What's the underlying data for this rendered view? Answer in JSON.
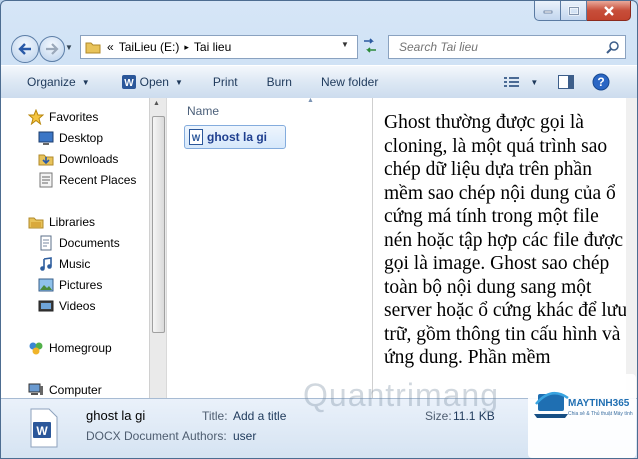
{
  "address": {
    "back_icon": "back-arrow-icon",
    "chevrons": "«",
    "drive": "TaiLieu (E:)",
    "separator": "▸",
    "folder": "Tai lieu"
  },
  "search": {
    "placeholder": "Search Tai lieu"
  },
  "toolbar": {
    "organize": "Organize",
    "open": "Open",
    "print": "Print",
    "burn": "Burn",
    "new_folder": "New folder"
  },
  "nav": {
    "favorites": "Favorites",
    "desktop": "Desktop",
    "downloads": "Downloads",
    "recent": "Recent Places",
    "libraries": "Libraries",
    "documents": "Documents",
    "music": "Music",
    "pictures": "Pictures",
    "videos": "Videos",
    "homegroup": "Homegroup",
    "computer": "Computer"
  },
  "files": {
    "column_name": "Name",
    "items": [
      "ghost la gi"
    ]
  },
  "preview": {
    "text": "Ghost thường được gọi là cloning, là một quá trình sao chép dữ liệu dựa trên phần mềm sao chép nội dung của ổ cứng má tính trong một file nén hoặc tập hợp các file được gọi là image. Ghost sao chép toàn bộ nội dung sang một server hoặc ổ cứng khác để lưu trữ, gồm thông tin cấu hình và ứng dung. Phần mềm"
  },
  "details": {
    "name": "ghost la gi",
    "type": "DOCX Document",
    "title_label": "Title:",
    "title_value": "Add a title",
    "authors_label": "Authors:",
    "authors_value": "user",
    "size_label": "Size:",
    "size_value": "11.1 KB"
  },
  "logo": {
    "text": "MAYTINH365",
    "subtext": "Chia sẻ & Thủ thuật Máy tính"
  },
  "watermark": "Quantrimang",
  "colors": {
    "accent": "#1e395b",
    "close": "#c74e3a",
    "selection": "#d6e8fb"
  }
}
